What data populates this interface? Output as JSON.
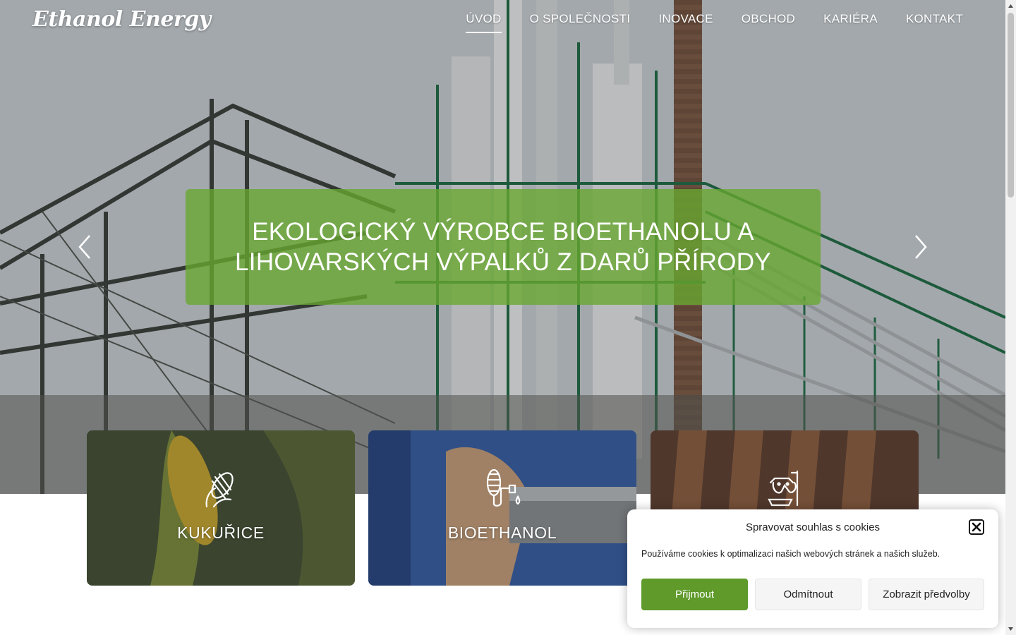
{
  "header": {
    "logo": "Ethanol Energy",
    "nav": [
      "ÚVOD",
      "O SPOLEČNOSTI",
      "INOVACE",
      "OBCHOD",
      "KARIÉRA",
      "KONTAKT"
    ]
  },
  "hero": {
    "headline": "EKOLOGICKÝ VÝROBCE BIOETHANOLU A LIHOVARSKÝCH VÝPALKŮ Z DARŮ PŘÍRODY",
    "prev_icon": "chevron-left-icon",
    "next_icon": "chevron-right-icon"
  },
  "cards": [
    {
      "label": "KUKUŘICE",
      "icon": "corn-icon"
    },
    {
      "label": "BIOETHANOL",
      "icon": "corn-fuel-icon"
    },
    {
      "label": "",
      "icon": "cattle-feed-icon"
    }
  ],
  "cookie": {
    "title": "Spravovat souhlas s cookies",
    "message": "Používáme cookies k optimalizaci našich webových stránek a našich služeb.",
    "accept": "Přijmout",
    "deny": "Odmítnout",
    "prefs": "Zobrazit předvolby"
  },
  "colors": {
    "brand_green": "#5f9a2a",
    "caption_green": "#68a830"
  }
}
